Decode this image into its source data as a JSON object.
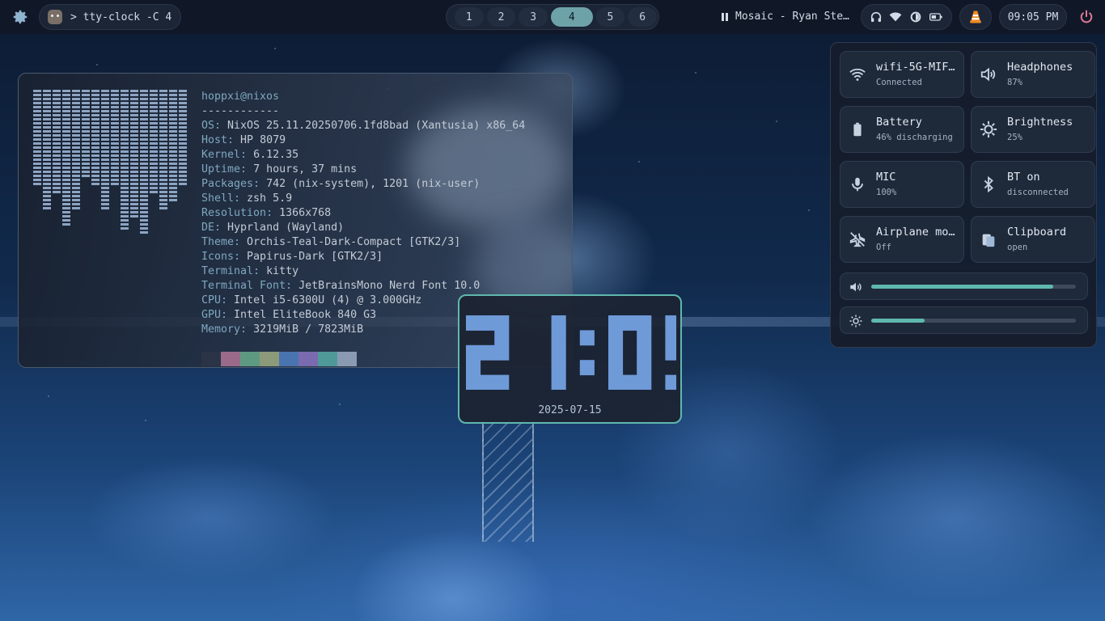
{
  "topbar": {
    "launcher_icon": "gear-icon",
    "active_window": "> tty-clock -C 4",
    "workspaces": [
      "1",
      "2",
      "3",
      "4",
      "5",
      "6"
    ],
    "active_workspace": "4",
    "media": "Mosaic - Ryan Ste…",
    "status_icons": [
      "headphones-icon",
      "wifi-icon",
      "brightness-icon",
      "battery-icon"
    ],
    "tray_icon": "vlc-icon",
    "time": "09:05 PM",
    "power_icon": "power-icon"
  },
  "fastfetch": {
    "userhost": "hoppxi@nixos",
    "separator": "------------",
    "lines": [
      {
        "key": "OS",
        "value": "NixOS 25.11.20250706.1fd8bad (Xantusia) x86_64"
      },
      {
        "key": "Host",
        "value": "HP 8079"
      },
      {
        "key": "Kernel",
        "value": "6.12.35"
      },
      {
        "key": "Uptime",
        "value": "7 hours, 37 mins"
      },
      {
        "key": "Packages",
        "value": "742 (nix-system), 1201 (nix-user)"
      },
      {
        "key": "Shell",
        "value": "zsh 5.9"
      },
      {
        "key": "Resolution",
        "value": "1366x768"
      },
      {
        "key": "DE",
        "value": "Hyprland (Wayland)"
      },
      {
        "key": "Theme",
        "value": "Orchis-Teal-Dark-Compact [GTK2/3]"
      },
      {
        "key": "Icons",
        "value": "Papirus-Dark [GTK2/3]"
      },
      {
        "key": "Terminal",
        "value": "kitty"
      },
      {
        "key": "Terminal Font",
        "value": "JetBrainsMono Nerd Font 10.0"
      },
      {
        "key": "CPU",
        "value": "Intel i5-6300U (4) @ 3.000GHz"
      },
      {
        "key": "GPU",
        "value": "Intel EliteBook 840 G3"
      },
      {
        "key": "Memory",
        "value": "3219MiB / 7823MiB"
      }
    ],
    "palette": [
      "#2b3446",
      "#9a6a8a",
      "#5e9a82",
      "#8c9a7a",
      "#4a74b0",
      "#7a6ab0",
      "#4f9a98",
      "#8a9ab2"
    ]
  },
  "clock": {
    "time": "21:05",
    "date": "2025-07-15",
    "digit_color": "#6f9ad8"
  },
  "quick_settings": {
    "tiles": [
      {
        "icon": "wifi-icon",
        "title": "wifi-5G-MIF…",
        "subtitle": "Connected"
      },
      {
        "icon": "speaker-icon",
        "title": "Headphones",
        "subtitle": "87%"
      },
      {
        "icon": "battery-icon",
        "title": "Battery",
        "subtitle": "46% discharging"
      },
      {
        "icon": "brightness-icon",
        "title": "Brightness",
        "subtitle": "25%"
      },
      {
        "icon": "mic-icon",
        "title": "MIC",
        "subtitle": "100%"
      },
      {
        "icon": "bluetooth-icon",
        "title": "BT on",
        "subtitle": "disconnected"
      },
      {
        "icon": "airplane-icon",
        "title": "Airplane mo…",
        "subtitle": "Off"
      },
      {
        "icon": "clipboard-icon",
        "title": "Clipboard",
        "subtitle": "open"
      }
    ],
    "volume_level": 0.89,
    "brightness_level": 0.26,
    "accent": "#5fb8ad"
  }
}
